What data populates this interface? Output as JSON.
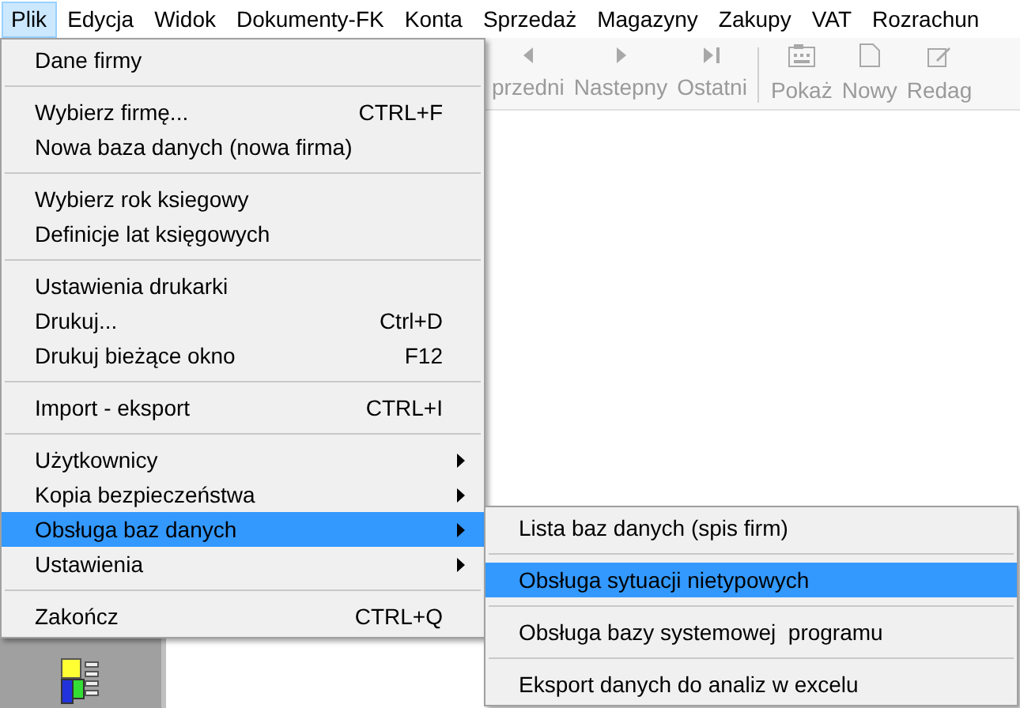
{
  "menubar": [
    {
      "label": "Plik",
      "selected": true
    },
    {
      "label": "Edycja",
      "selected": false
    },
    {
      "label": "Widok",
      "selected": false
    },
    {
      "label": "Dokumenty-FK",
      "selected": false
    },
    {
      "label": "Konta",
      "selected": false
    },
    {
      "label": "Sprzedaż",
      "selected": false
    },
    {
      "label": "Magazyny",
      "selected": false
    },
    {
      "label": "Zakupy",
      "selected": false
    },
    {
      "label": "VAT",
      "selected": false
    },
    {
      "label": "Rozrachun",
      "selected": false
    }
  ],
  "toolbar": [
    {
      "kind": "button",
      "label": "przedni"
    },
    {
      "kind": "button",
      "label": "Nastepny"
    },
    {
      "kind": "button",
      "label": "Ostatni"
    },
    {
      "kind": "sep"
    },
    {
      "kind": "button",
      "label": "Pokaż"
    },
    {
      "kind": "button",
      "label": "Nowy"
    },
    {
      "kind": "button",
      "label": "Redag"
    }
  ],
  "menu": [
    {
      "kind": "item",
      "label": "Dane firmy",
      "selected": false
    },
    {
      "kind": "separator"
    },
    {
      "kind": "item",
      "label": "Wybierz firmę...",
      "shortcut": "CTRL+F",
      "selected": false
    },
    {
      "kind": "item",
      "label": "Nowa baza danych (nowa firma)",
      "selected": false
    },
    {
      "kind": "separator"
    },
    {
      "kind": "item",
      "label": "Wybierz rok ksiegowy",
      "selected": false
    },
    {
      "kind": "item",
      "label": "Definicje lat księgowych",
      "selected": false
    },
    {
      "kind": "separator"
    },
    {
      "kind": "item",
      "label": "Ustawienia drukarki",
      "selected": false
    },
    {
      "kind": "item",
      "label": "Drukuj...",
      "shortcut": "Ctrl+D",
      "selected": false
    },
    {
      "kind": "item",
      "label": "Drukuj bieżące okno",
      "shortcut": "F12",
      "selected": false
    },
    {
      "kind": "separator"
    },
    {
      "kind": "item",
      "label": "Import - eksport",
      "shortcut": "CTRL+I",
      "selected": false
    },
    {
      "kind": "separator"
    },
    {
      "kind": "submenu",
      "label": "Użytkownicy",
      "selected": false
    },
    {
      "kind": "submenu",
      "label": "Kopia bezpieczeństwa",
      "selected": false
    },
    {
      "kind": "submenu",
      "label": "Obsługa baz danych",
      "selected": true
    },
    {
      "kind": "submenu",
      "label": "Ustawienia",
      "selected": false
    },
    {
      "kind": "separator"
    },
    {
      "kind": "item",
      "label": "Zakończ",
      "shortcut": "CTRL+Q",
      "selected": false
    }
  ],
  "submenu": [
    {
      "kind": "item",
      "label": "Lista baz danych (spis firm)",
      "selected": false
    },
    {
      "kind": "separator"
    },
    {
      "kind": "item",
      "label": "Obsługa sytuacji nietypowych",
      "selected": true
    },
    {
      "kind": "separator"
    },
    {
      "kind": "item",
      "label": "Obsługa bazy systemowej  programu",
      "selected": false
    },
    {
      "kind": "separator"
    },
    {
      "kind": "item",
      "label": "Eksport danych do analiz w excelu",
      "selected": false
    }
  ]
}
